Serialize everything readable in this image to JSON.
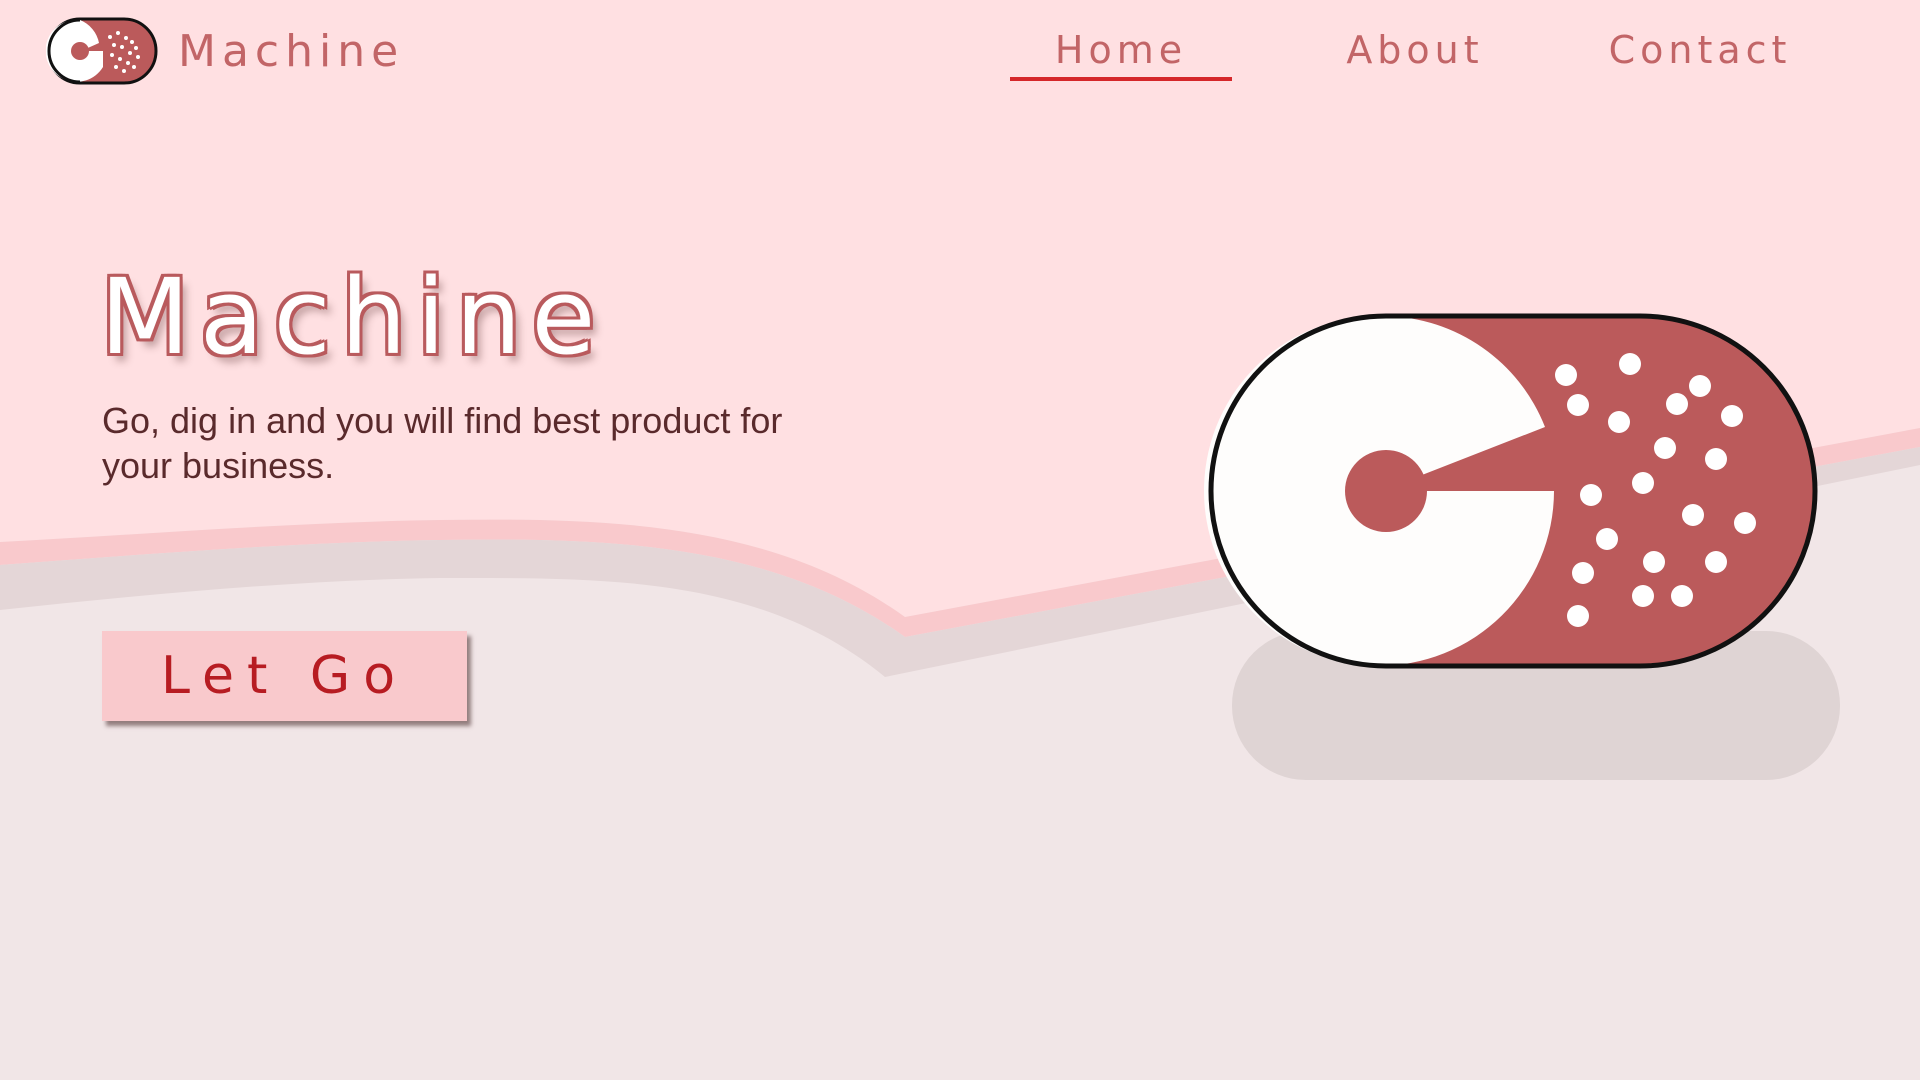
{
  "brand": {
    "name": "Machine",
    "logo_icon": "machine-pill-logo-icon"
  },
  "nav": {
    "items": [
      {
        "label": "Home",
        "active": true
      },
      {
        "label": "About",
        "active": false
      },
      {
        "label": "Contact",
        "active": false
      }
    ]
  },
  "hero": {
    "title": "Machine",
    "subtitle": "Go, dig in and you will find best product for your business.",
    "cta_label": "Let Go"
  },
  "illustration": {
    "icon": "machine-pill-illustration-icon"
  },
  "colors": {
    "background_top": "#ffe0e2",
    "background_bottom": "#f1e6e7",
    "accent": "#bb5a5b",
    "accent_text": "#c26567",
    "active_underline": "#d5272a",
    "button_bg": "#f9c9cc",
    "button_text": "#b71c22",
    "subtitle_text": "#5a2a2c"
  }
}
